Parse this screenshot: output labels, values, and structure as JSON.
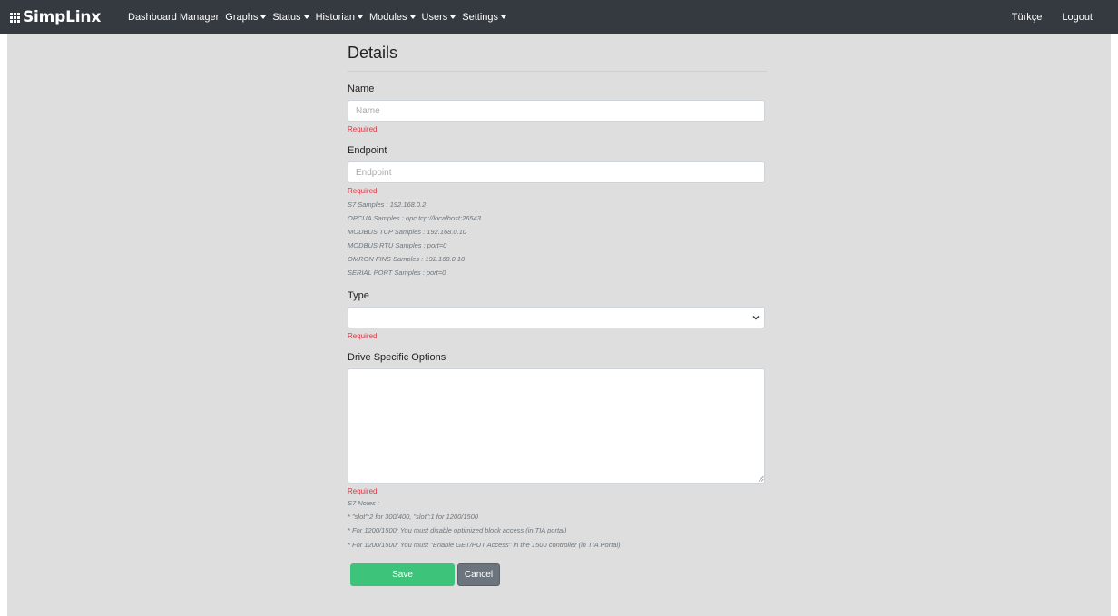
{
  "navbar": {
    "brand": "SimpLinx",
    "menu": [
      {
        "label": "Dashboard Manager",
        "dropdown": false
      },
      {
        "label": "Graphs",
        "dropdown": true
      },
      {
        "label": "Status",
        "dropdown": true
      },
      {
        "label": "Historian",
        "dropdown": true
      },
      {
        "label": "Modules",
        "dropdown": true
      },
      {
        "label": "Users",
        "dropdown": true
      },
      {
        "label": "Settings",
        "dropdown": true
      }
    ],
    "language": "Türkçe",
    "logout": "Logout"
  },
  "form": {
    "title": "Details",
    "name": {
      "label": "Name",
      "placeholder": "Name",
      "value": "",
      "error": "Required"
    },
    "endpoint": {
      "label": "Endpoint",
      "placeholder": "Endpoint",
      "value": "",
      "error": "Required",
      "samples": [
        "S7 Samples : 192.168.0.2",
        "OPCUA Samples : opc.tcp://localhost:26543",
        "MODBUS TCP Samples : 192.168.0.10",
        "MODBUS RTU Samples : port=0",
        "OMRON FINS Samples : 192.168.0.10",
        "SERIAL PORT Samples : port=0"
      ]
    },
    "type": {
      "label": "Type",
      "selected": "",
      "error": "Required"
    },
    "options": {
      "label": "Drive Specific Options",
      "value": "",
      "error": "Required",
      "notes": [
        "S7 Notes :",
        "* \"slot\":2 for 300/400, \"slot\":1 for 1200/1500",
        "* For 1200/1500; You must disable optimized block access (in TIA portal)",
        "* For 1200/1500; You must \"Enable GET/PUT Access\" in the 1500 controller (in TIA Portal)"
      ]
    },
    "save_label": "Save",
    "cancel_label": "Cancel"
  },
  "colors": {
    "navbar": "#343a40",
    "background": "#dedede",
    "error": "#dc3545",
    "save": "#3ec47a",
    "cancel": "#6c757d"
  },
  "icons": {
    "brand": "grid-dots-icon",
    "dropdown": "caret-down-icon",
    "select": "chevron-down-icon",
    "textarea": "resize-handle-icon"
  }
}
